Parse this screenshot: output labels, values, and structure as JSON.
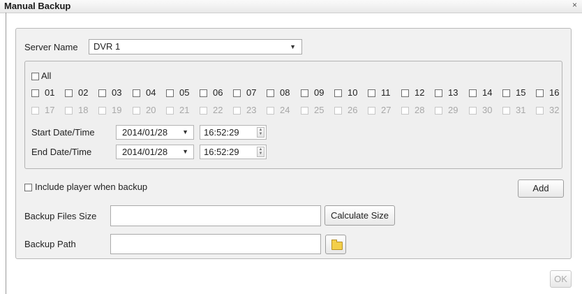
{
  "window": {
    "title": "Manual Backup",
    "close_glyph": "×"
  },
  "server": {
    "label": "Server Name",
    "selected": "DVR 1"
  },
  "channels": {
    "all_label": "All",
    "row1": [
      "01",
      "02",
      "03",
      "04",
      "05",
      "06",
      "07",
      "08",
      "09",
      "10",
      "11",
      "12",
      "13",
      "14",
      "15",
      "16"
    ],
    "row2": [
      "17",
      "18",
      "19",
      "20",
      "21",
      "22",
      "23",
      "24",
      "25",
      "26",
      "27",
      "28",
      "29",
      "30",
      "31",
      "32"
    ]
  },
  "start": {
    "label": "Start Date/Time",
    "date": "2014/01/28",
    "time": "16:52:29"
  },
  "end": {
    "label": "End Date/Time",
    "date": "2014/01/28",
    "time": "16:52:29"
  },
  "include_player": {
    "label": "Include player when backup"
  },
  "add_button": "Add",
  "files_size": {
    "label": "Backup Files Size",
    "value": "",
    "button": "Calculate Size"
  },
  "backup_path": {
    "label": "Backup Path",
    "value": "",
    "icon": "folder-icon"
  },
  "ok_button": "OK"
}
